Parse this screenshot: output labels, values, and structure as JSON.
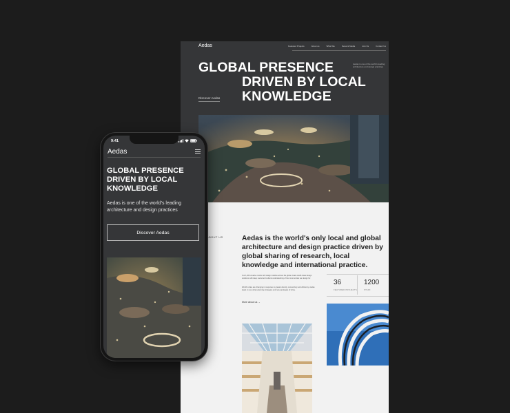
{
  "desktop": {
    "logo": "Aedas",
    "nav": [
      "Featured Projects",
      "About us",
      "What We",
      "News & Media",
      "Join Us",
      "Contact Us"
    ],
    "headline_line1": "GLOBAL PRESENCE",
    "headline_line2": "DRIVEN BY LOCAL\nKNOWLEDGE",
    "side_text": "Aedas is one of the world's leading architecture and design practices",
    "discover_link": "Discover Aedas",
    "about_label": "ABOUT US",
    "lead": "Aedas is the world's only local and global architecture and design practice driven by global sharing of research, local knowledge and international practice.",
    "body1": "Our 1,200 creative minds with design studios across the globe create world-class design solutions with deep social and cultural understanding of the communities we design for.",
    "body2": "World's cities are changing in response to greater density, connectivity and efficiency. Aedas leads in new urban planning strategies and new typologies of living.",
    "more_link": "More about us",
    "stats": [
      {
        "value": "36",
        "label": "FEATURED PROJECTS"
      },
      {
        "value": "1200",
        "label": "STAFF"
      }
    ]
  },
  "phone": {
    "time": "9:41",
    "logo": "Aedas",
    "headline": "GLOBAL PRESENCE\nDRIVEN BY LOCAL\nKNOWLEDGE",
    "subtext": "Aedas is one of the world's leading\narchitecture and design practices",
    "button": "Discover Aedas"
  },
  "colors": {
    "background": "#1c1c1c",
    "panel_dark": "#353638",
    "panel_light": "#f2f2f2",
    "phone_frame": "#151515"
  }
}
